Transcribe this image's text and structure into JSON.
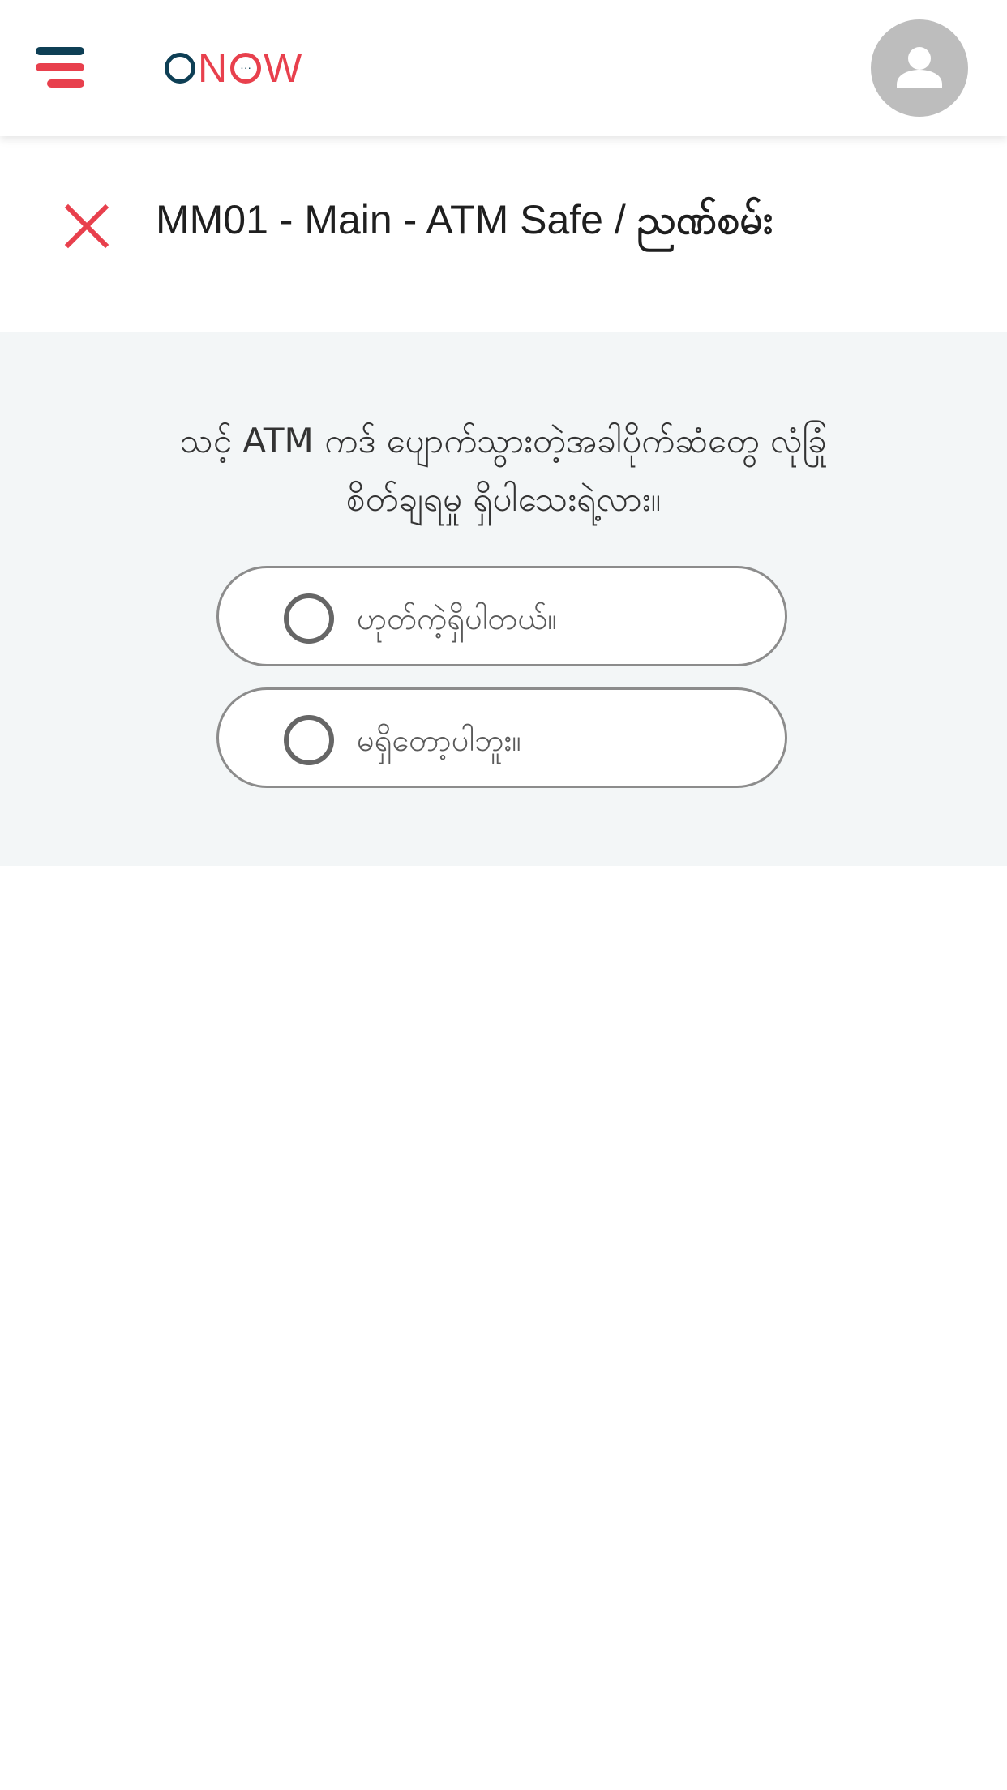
{
  "header": {
    "logo": {
      "parts": [
        "O",
        "N",
        "W"
      ],
      "ring_dots": "···"
    },
    "menu_icon": "hamburger-menu-icon",
    "avatar_icon": "person-icon"
  },
  "title_row": {
    "close_icon": "close-icon",
    "title_prefix": "MM01 - Main - ATM Safe / ",
    "title_suffix": "ညဏ်စမ်း"
  },
  "question": {
    "line1": "သင့် ATM ကဒ် ပျောက်သွားတဲ့အခါပိုက်ဆံတွေ လုံခြုံ",
    "line2": "စိတ်ချရမှု ရှိပါသေးရဲ့လား။",
    "options": [
      {
        "label": "ဟုတ်ကဲ့ရှိပါတယ်။"
      },
      {
        "label": "မရှိတော့ပါဘူး။"
      }
    ]
  },
  "colors": {
    "brand_navy": "#0e3f55",
    "brand_red": "#e8404d",
    "panel_bg": "#f3f6f7",
    "avatar_bg": "#bdbdbd",
    "option_border": "#8c8c8c",
    "radio_ring": "#666666"
  }
}
